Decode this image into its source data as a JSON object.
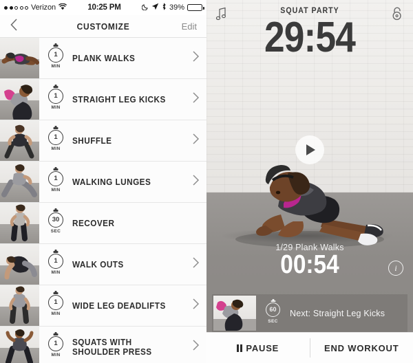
{
  "status_bar": {
    "signal_dots_filled": 2,
    "signal_dots_total": 5,
    "carrier": "Verizon",
    "wifi_icon": "wifi-icon",
    "time": "10:25 PM",
    "moon_icon": "moon-icon",
    "location_icon": "location-arrow-icon",
    "bluetooth_icon": "bluetooth-icon",
    "battery_text": "39%",
    "battery_percent": 39
  },
  "nav": {
    "back_icon": "chevron-left-icon",
    "title": "CUSTOMIZE",
    "edit_label": "Edit"
  },
  "exercise_list": [
    {
      "name": "PLANK WALKS",
      "name_line2": "",
      "duration": "1",
      "unit": "MIN",
      "chevron": true
    },
    {
      "name": "STRAIGHT LEG KICKS",
      "name_line2": "",
      "duration": "1",
      "unit": "MIN",
      "chevron": true
    },
    {
      "name": "SHUFFLE",
      "name_line2": "",
      "duration": "1",
      "unit": "MIN",
      "chevron": true
    },
    {
      "name": "WALKING LUNGES",
      "name_line2": "",
      "duration": "1",
      "unit": "MIN",
      "chevron": true
    },
    {
      "name": "RECOVER",
      "name_line2": "",
      "duration": "30",
      "unit": "SEC",
      "chevron": false
    },
    {
      "name": "WALK OUTS",
      "name_line2": "",
      "duration": "1",
      "unit": "MIN",
      "chevron": true
    },
    {
      "name": "WIDE LEG DEADLIFTS",
      "name_line2": "",
      "duration": "1",
      "unit": "MIN",
      "chevron": true
    },
    {
      "name": "SQUATS WITH",
      "name_line2": "SHOULDER PRESS",
      "duration": "1",
      "unit": "MIN",
      "chevron": true
    }
  ],
  "player": {
    "music_icon": "music-note-icon",
    "lock_icon": "lock-open-icon",
    "workout_title": "SQUAT PARTY",
    "total_time_remaining": "29:54",
    "play_icon": "play-icon",
    "current_exercise_label": "1/29 Plank Walks",
    "current_index": 1,
    "total_exercises": 29,
    "current_exercise_name": "Plank Walks",
    "exercise_time_remaining": "00:54",
    "info_icon": "info-icon",
    "next": {
      "duration": "60",
      "unit": "SEC",
      "label": "Next: Straight Leg Kicks",
      "exercise_name": "Straight Leg Kicks"
    },
    "footer": {
      "pause_label": "PAUSE",
      "pause_icon": "pause-icon",
      "end_label": "END WORKOUT"
    }
  },
  "colors": {
    "accent_magenta": "#b8268f",
    "text_dark": "#2c2c2c",
    "text_muted": "#8a8a8a",
    "list_bg": "#fcfcfc",
    "floor_gray": "#8e8b88",
    "wall_white": "#eceae7"
  }
}
